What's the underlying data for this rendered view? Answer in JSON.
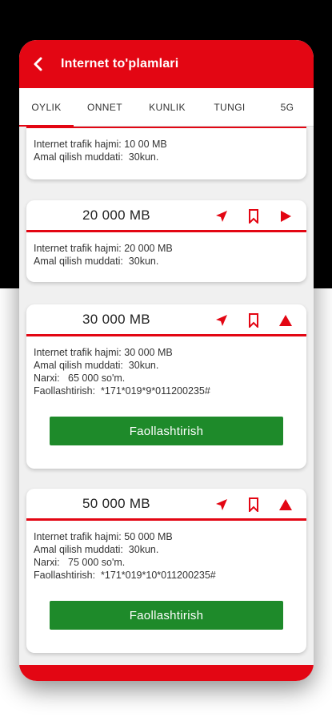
{
  "appbar": {
    "title": "Internet to'plamlari",
    "back_icon": "arrow-left-icon"
  },
  "tabs": [
    {
      "label": "OYLIK",
      "active": true
    },
    {
      "label": "ONNET",
      "active": false
    },
    {
      "label": "KUNLIK",
      "active": false
    },
    {
      "label": "TUNGI",
      "active": false
    },
    {
      "label": "5G",
      "active": false
    }
  ],
  "cards": [
    {
      "amount": "",
      "rows": [
        "Internet trafik hajmi: 10 00 MB",
        "Amal qilish muddati:  30kun."
      ]
    },
    {
      "amount": "20 000  MB",
      "rows": [
        "Internet trafik hajmi: 20 000 MB",
        "Amal qilish muddati:  30kun."
      ],
      "toggle_icon": "play-right-icon"
    },
    {
      "amount": "30 000  MB",
      "rows": [
        "Internet trafik hajmi: 30 000 MB",
        "Amal qilish muddati:  30kun.",
        "Narxi:   65 000 so'm.",
        "Faollashtirish:  *171*019*9*011200235#"
      ],
      "button": "Faollashtirish",
      "toggle_icon": "triangle-up-icon"
    },
    {
      "amount": "50 000 MB",
      "rows": [
        "Internet trafik hajmi: 50 000 MB",
        "Amal qilish muddati:  30kun.",
        "Narxi:   75 000 so'm.",
        "Faollashtirish:  *171*019*10*011200235#"
      ],
      "button": "Faollashtirish",
      "toggle_icon": "triangle-up-icon"
    }
  ],
  "colors": {
    "accent": "#e30613",
    "button": "#1e8a2a"
  }
}
